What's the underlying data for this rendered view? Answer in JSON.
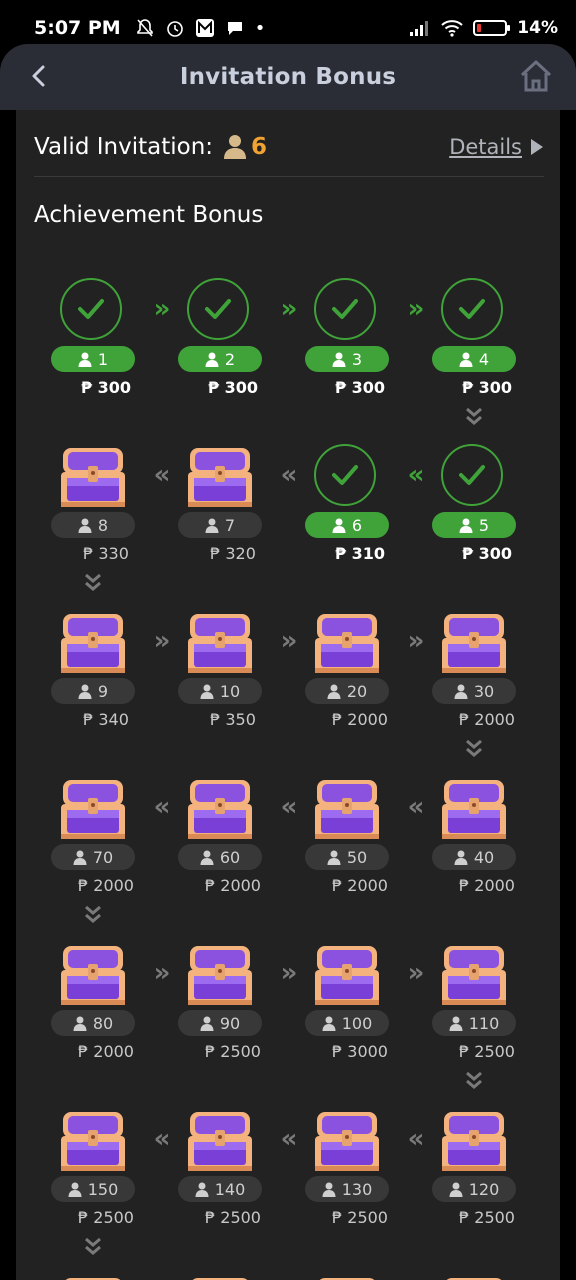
{
  "status": {
    "time": "5:07 PM",
    "battery_pct": "14%",
    "battery_level": 0.14
  },
  "appbar": {
    "title": "Invitation Bonus"
  },
  "summary": {
    "label": "Valid Invitation:",
    "count": "6",
    "details_label": "Details"
  },
  "section": {
    "title": "Achievement Bonus"
  },
  "colors": {
    "done_green": "#3fa339",
    "accent_orange": "#f0a332",
    "panel_bg": "#222222",
    "appbar_bg": "#2a2d36"
  },
  "currency": "₱",
  "tiers": [
    {
      "count": "1",
      "reward": "₱ 300",
      "done": true
    },
    {
      "count": "2",
      "reward": "₱ 300",
      "done": true
    },
    {
      "count": "3",
      "reward": "₱ 300",
      "done": true
    },
    {
      "count": "4",
      "reward": "₱ 300",
      "done": true
    },
    {
      "count": "5",
      "reward": "₱ 300",
      "done": true
    },
    {
      "count": "6",
      "reward": "₱ 310",
      "done": true
    },
    {
      "count": "7",
      "reward": "₱ 320",
      "done": false
    },
    {
      "count": "8",
      "reward": "₱ 330",
      "done": false
    },
    {
      "count": "9",
      "reward": "₱ 340",
      "done": false
    },
    {
      "count": "10",
      "reward": "₱ 350",
      "done": false
    },
    {
      "count": "20",
      "reward": "₱ 2000",
      "done": false
    },
    {
      "count": "30",
      "reward": "₱ 2000",
      "done": false
    },
    {
      "count": "40",
      "reward": "₱ 2000",
      "done": false
    },
    {
      "count": "50",
      "reward": "₱ 2000",
      "done": false
    },
    {
      "count": "60",
      "reward": "₱ 2000",
      "done": false
    },
    {
      "count": "70",
      "reward": "₱ 2000",
      "done": false
    },
    {
      "count": "80",
      "reward": "₱ 2000",
      "done": false
    },
    {
      "count": "90",
      "reward": "₱ 2500",
      "done": false
    },
    {
      "count": "100",
      "reward": "₱ 3000",
      "done": false
    },
    {
      "count": "110",
      "reward": "₱ 2500",
      "done": false
    },
    {
      "count": "120",
      "reward": "₱ 2500",
      "done": false
    },
    {
      "count": "130",
      "reward": "₱ 2500",
      "done": false
    },
    {
      "count": "140",
      "reward": "₱ 2500",
      "done": false
    },
    {
      "count": "150",
      "reward": "₱ 2500",
      "done": false
    }
  ]
}
